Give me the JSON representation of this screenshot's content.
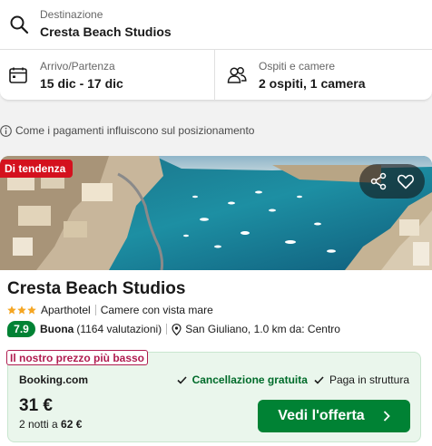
{
  "search": {
    "destination_label": "Destinazione",
    "destination_value": "Cresta Beach Studios",
    "dates_label": "Arrivo/Partenza",
    "dates_value": "15 dic - 17 dic",
    "guests_label": "Ospiti e camere",
    "guests_value": "2 ospiti, 1 camera"
  },
  "info_text": "Come i pagamenti influiscono sul posizionamento",
  "hotel": {
    "badge": "Di tendenza",
    "name": "Cresta Beach Studios",
    "stars": 3,
    "type": "Aparthotel",
    "room_feature": "Camere con vista mare",
    "score": "7.9",
    "score_word": "Buona",
    "reviews": "(1164 valutazioni)",
    "location": "San Giuliano, 1.0 km da: Centro"
  },
  "offer": {
    "tag": "Il nostro prezzo più basso",
    "provider": "Booking.com",
    "benefit_1": "Cancellazione gratuita",
    "benefit_2": "Paga in struttura",
    "price": "31 €",
    "nights_prefix": "2 notti a",
    "total": "62 €",
    "cta": "Vedi l'offerta"
  },
  "colors": {
    "accent_green": "#008234",
    "trend_red": "#d4111e",
    "tag_pink": "#b01c50",
    "star_orange": "#f5a623"
  },
  "icons": [
    "search-icon",
    "calendar-icon",
    "guests-icon",
    "info-icon",
    "share-icon",
    "heart-icon",
    "star-icon",
    "location-pin-icon",
    "check-icon",
    "chevron-right-icon"
  ]
}
